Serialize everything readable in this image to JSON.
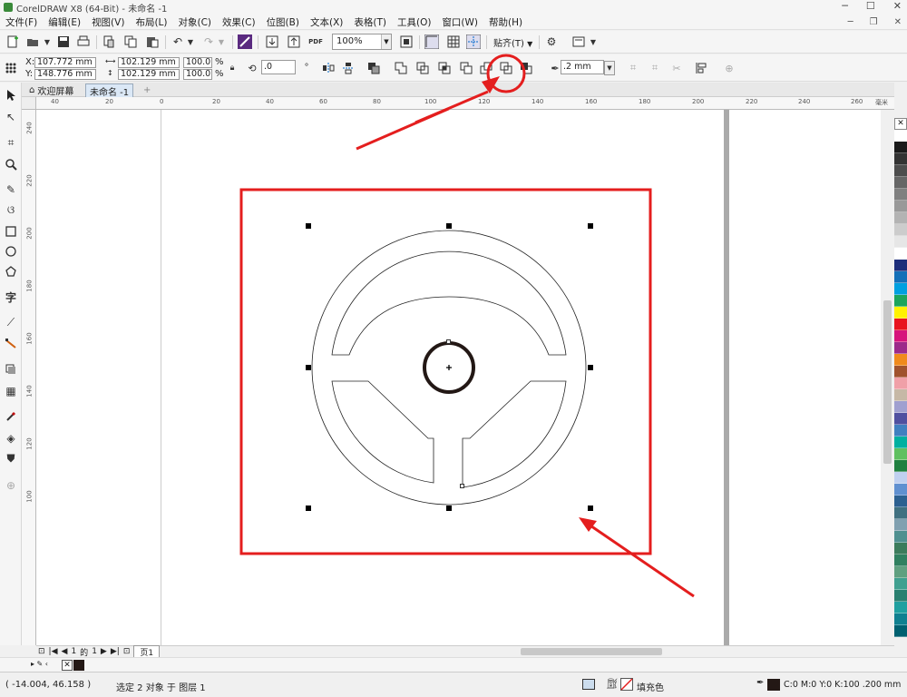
{
  "window": {
    "title": "CorelDRAW X8 (64-Bit) - 未命名 -1",
    "min": "─",
    "max": "☐",
    "close": "✕"
  },
  "menu": {
    "items": [
      "文件(F)",
      "编辑(E)",
      "视图(V)",
      "布局(L)",
      "对象(C)",
      "效果(C)",
      "位图(B)",
      "文本(X)",
      "表格(T)",
      "工具(O)",
      "窗口(W)",
      "帮助(H)"
    ]
  },
  "toolbar": {
    "zoom": "100%",
    "snap_label": "贴齐(T)"
  },
  "propbar": {
    "x_label": "X:",
    "x_value": "107.772 mm",
    "y_label": "Y:",
    "y_value": "148.776 mm",
    "w_value": "102.129 mm",
    "h_value": "102.129 mm",
    "scale_w": "100.0",
    "scale_h": "100.0",
    "pct1": "%",
    "pct2": "%",
    "rotation": ".0",
    "outline_width": ".2 mm"
  },
  "tabs": {
    "welcome": "欢迎屏幕",
    "doc": "未命名 -1",
    "add": "+"
  },
  "ruler": {
    "top": [
      "40",
      "20",
      "0",
      "20",
      "40",
      "60",
      "80",
      "100",
      "120",
      "140",
      "160",
      "180",
      "200",
      "220",
      "240",
      "260"
    ],
    "unit": "毫米",
    "left": [
      "240",
      "220",
      "200",
      "180",
      "160",
      "140",
      "120",
      "100"
    ]
  },
  "pagenav": {
    "current": "1",
    "of": "的",
    "total": "1",
    "page_tab": "页1"
  },
  "status": {
    "coords": "( -14.004, 46.158 )",
    "selection": "选定 2 对象 于 图层 1",
    "fill": "填充色",
    "outline": "C:0 M:0 Y:0 K:100  .200 mm"
  },
  "palette_colors": [
    "#ffffff",
    "#1a1a1a",
    "#333333",
    "#4d4d4d",
    "#666666",
    "#808080",
    "#999999",
    "#b3b3b3",
    "#cccccc",
    "#e6e6e6",
    "#ffffff",
    "#1d2d7a",
    "#1470b8",
    "#00a0e0",
    "#1ca55c",
    "#fff200",
    "#e8141e",
    "#d6147c",
    "#9c2a8a",
    "#f08a1c",
    "#a0522d",
    "#f0a0a8",
    "#c6b8a6",
    "#a0a0d0",
    "#5050a0",
    "#4080c0",
    "#00b0a0",
    "#60c060",
    "#208040",
    "#c0d0f0",
    "#6090d0",
    "#2c6090",
    "#407080",
    "#80a0b0",
    "#509090",
    "#3c7c5c",
    "#308060",
    "#60a080",
    "#40a090",
    "#2a8070",
    "#20a0a0",
    "#108090",
    "#006070"
  ],
  "colors": {
    "annotation": "#e41e1e",
    "accent": "#0078d7"
  }
}
